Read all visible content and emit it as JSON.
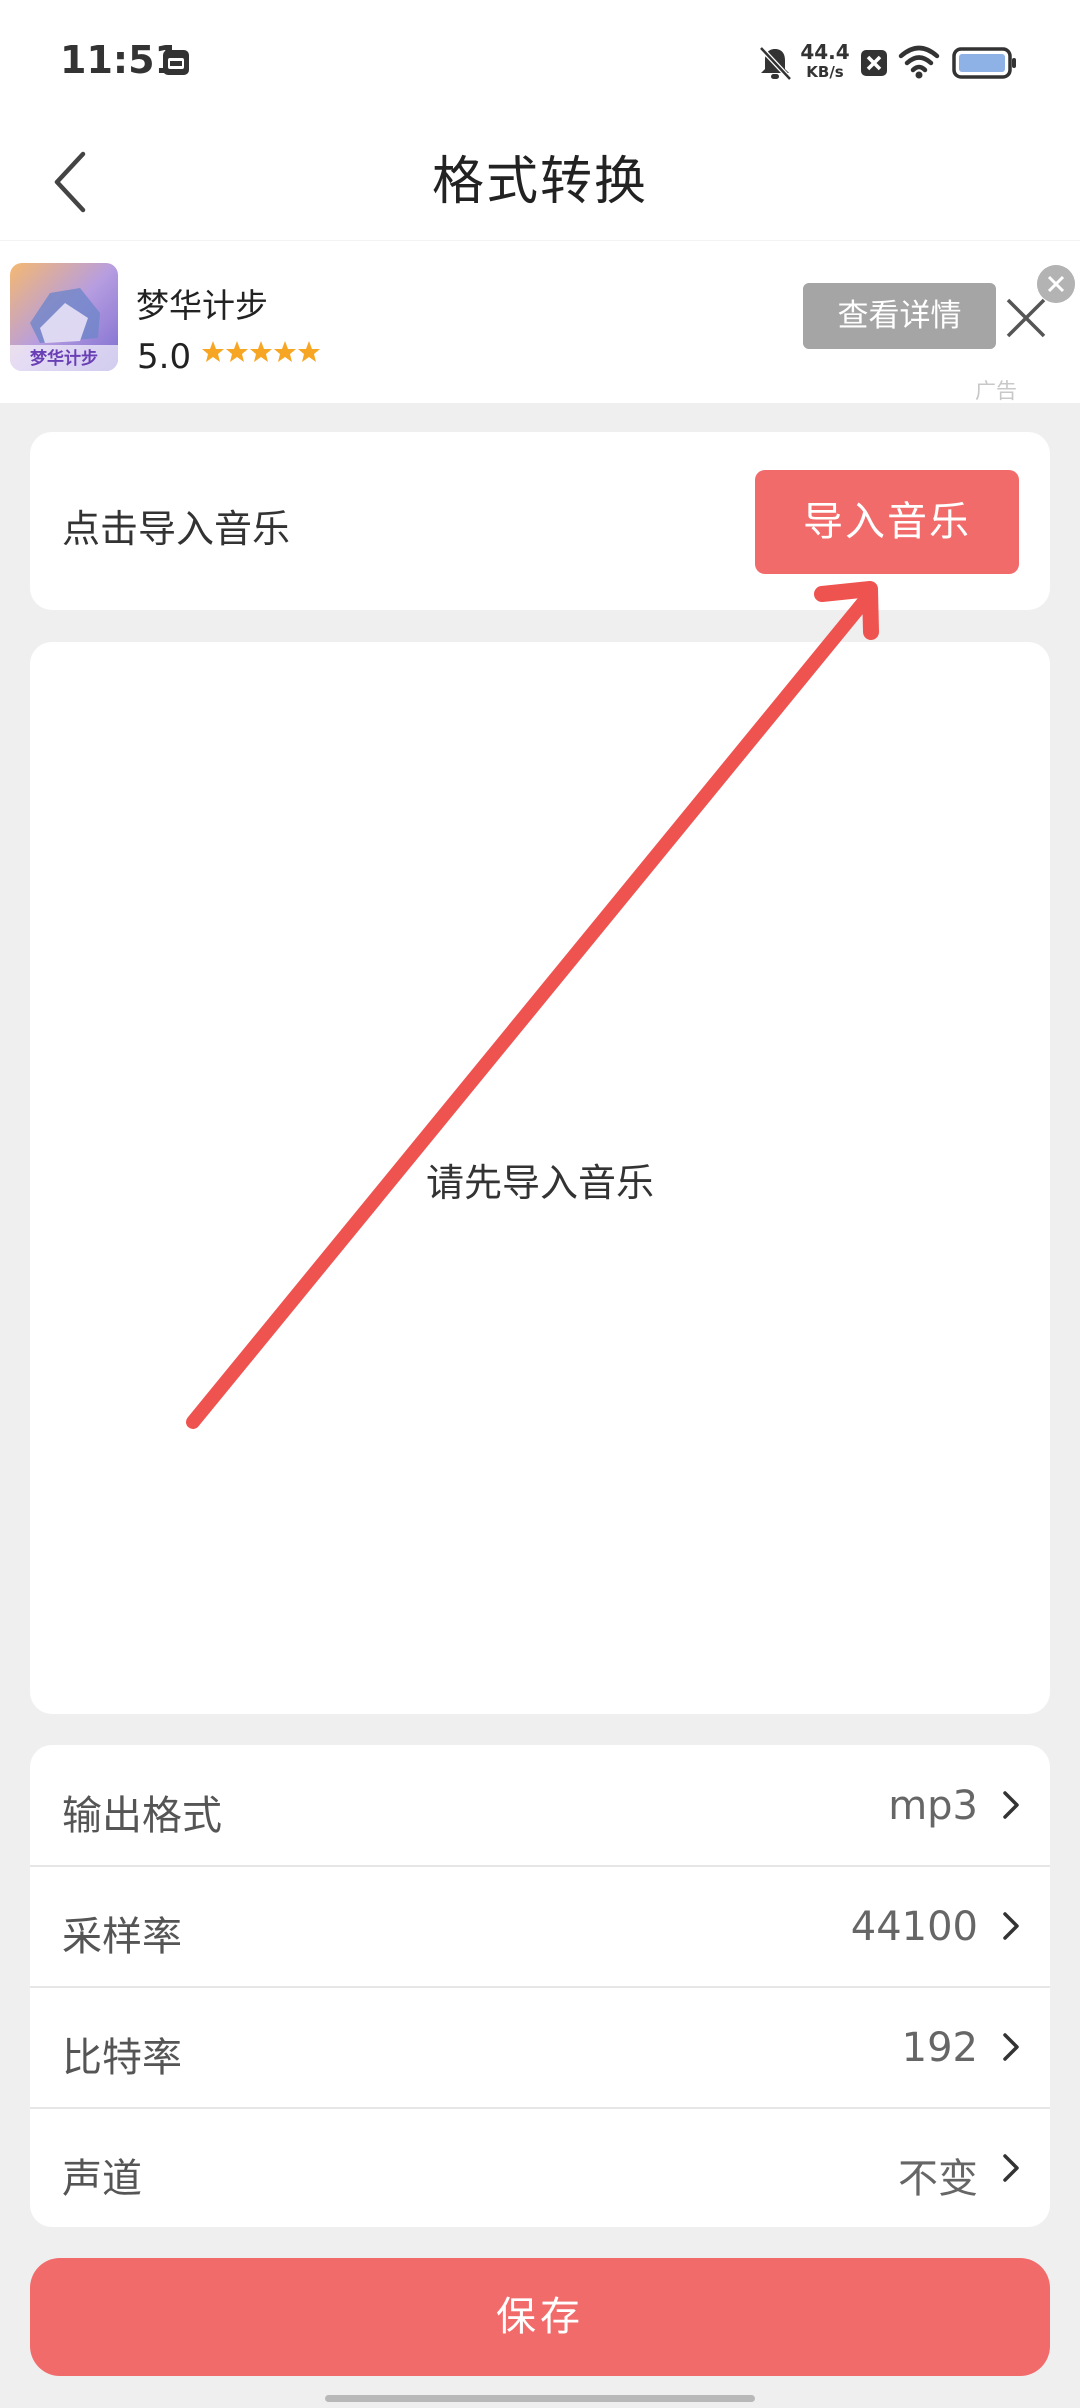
{
  "status_bar": {
    "time": "11:51",
    "net_speed_value": "44.4",
    "net_speed_unit": "KB/s"
  },
  "header": {
    "title": "格式转换"
  },
  "ad": {
    "logo_text": "梦华计步",
    "app_name": "梦华计步",
    "rating": "5.0",
    "stars": 5,
    "details_button": "查看详情",
    "ad_label": "广告"
  },
  "import_card": {
    "prompt": "点击导入音乐",
    "button_label": "导入音乐"
  },
  "content": {
    "empty_message": "请先导入音乐"
  },
  "settings": {
    "rows": [
      {
        "label": "输出格式",
        "value": "mp3"
      },
      {
        "label": "采样率",
        "value": "44100"
      },
      {
        "label": "比特率",
        "value": "192"
      },
      {
        "label": "声道",
        "value": "不变"
      }
    ]
  },
  "footer": {
    "save_label": "保存"
  },
  "colors": {
    "accent": "#f26b6b",
    "arrow": "#ef5350",
    "background": "#efefef"
  }
}
